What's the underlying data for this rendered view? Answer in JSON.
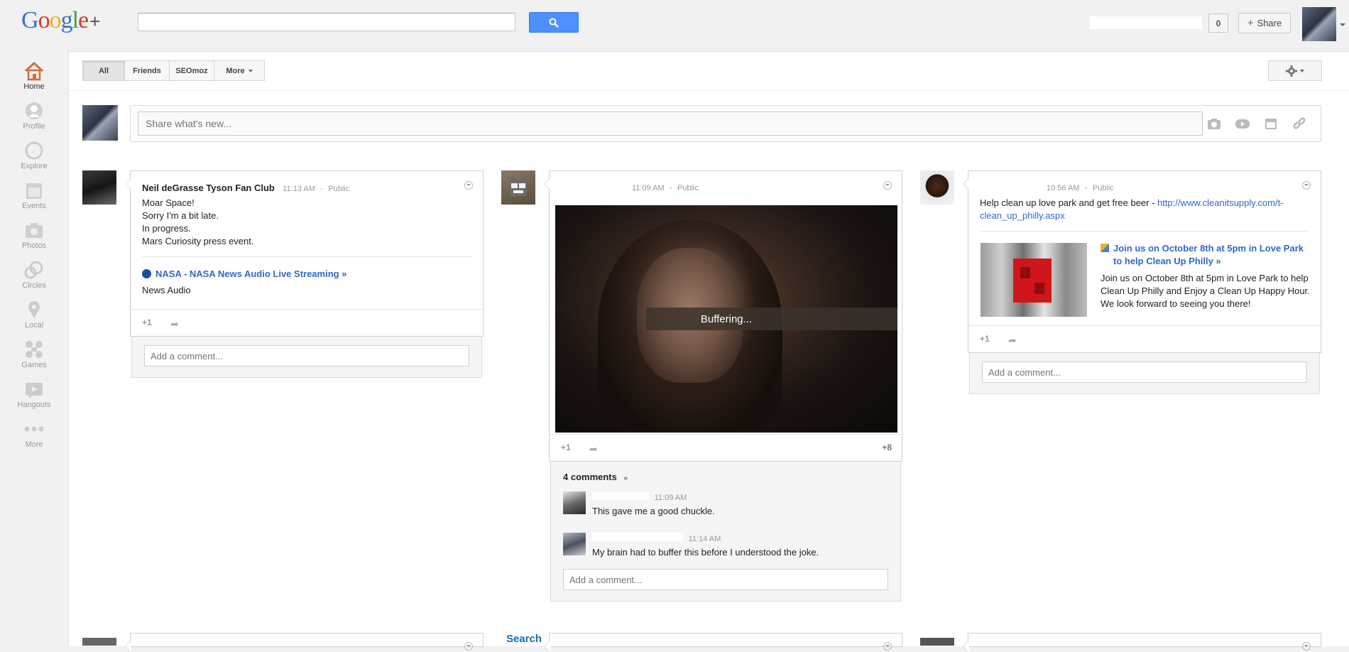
{
  "app": {
    "logo_text": "Google+",
    "search_placeholder": "",
    "notification_count": "0",
    "share_label": "Share"
  },
  "nav": [
    {
      "label": "Home",
      "icon": "home-icon"
    },
    {
      "label": "Profile",
      "icon": "profile-icon"
    },
    {
      "label": "Explore",
      "icon": "compass-icon"
    },
    {
      "label": "Events",
      "icon": "calendar-icon"
    },
    {
      "label": "Photos",
      "icon": "camera-icon"
    },
    {
      "label": "Circles",
      "icon": "circles-icon"
    },
    {
      "label": "Local",
      "icon": "map-pin-icon"
    },
    {
      "label": "Games",
      "icon": "games-icon"
    },
    {
      "label": "Hangouts",
      "icon": "video-camera-icon"
    },
    {
      "label": "More",
      "icon": "more-dots-icon"
    }
  ],
  "filters": {
    "all": "All",
    "friends": "Friends",
    "seomoz": "SEOmoz",
    "more": "More"
  },
  "sharebox": {
    "placeholder": "Share what's new..."
  },
  "posts": {
    "p1": {
      "author": "Neil deGrasse Tyson Fan Club",
      "time": "11:13 AM",
      "visibility": "Public",
      "lines": [
        "Moar Space!",
        "Sorry I'm a bit late.",
        "In progress.",
        "Mars Curiosity press event."
      ],
      "link_title": "NASA - NASA News Audio Live Streaming »",
      "link_desc": "News Audio",
      "plus_one": "+1",
      "comment_placeholder": "Add a comment..."
    },
    "p2": {
      "time": "11:09 AM",
      "visibility": "Public",
      "video_status": "Buffering...",
      "plus_one": "+1",
      "plus_count": "+8",
      "comments_label": "4 comments",
      "comments": [
        {
          "time": "11:09 AM",
          "text": "This gave me a good chuckle."
        },
        {
          "time": "11:14 AM",
          "text": "My brain had to buffer this before I understood the joke."
        }
      ],
      "comment_placeholder": "Add a comment..."
    },
    "p3": {
      "time": "10:56 AM",
      "visibility": "Public",
      "text": "Help clean up love park and get free beer - ",
      "url_line1": "http://www.cleanitsupply.com/t-",
      "url_line2": "clean_up_philly.aspx",
      "link_title_1": "Join us on October 8th at 5pm in Love Park",
      "link_title_2": "to help Clean Up Philly »",
      "link_desc_lines": [
        "Join us on October 8th at 5pm in Love Park to help",
        "Clean Up Philly and Enjoy a Clean Up Happy Hour.",
        "We look forward to seeing you there!"
      ],
      "plus_one": "+1",
      "comment_placeholder": "Add a comment..."
    }
  },
  "bottom": {
    "search_label": "Search"
  },
  "colors": {
    "accent": "#4d90fe",
    "link": "#3366cc"
  }
}
